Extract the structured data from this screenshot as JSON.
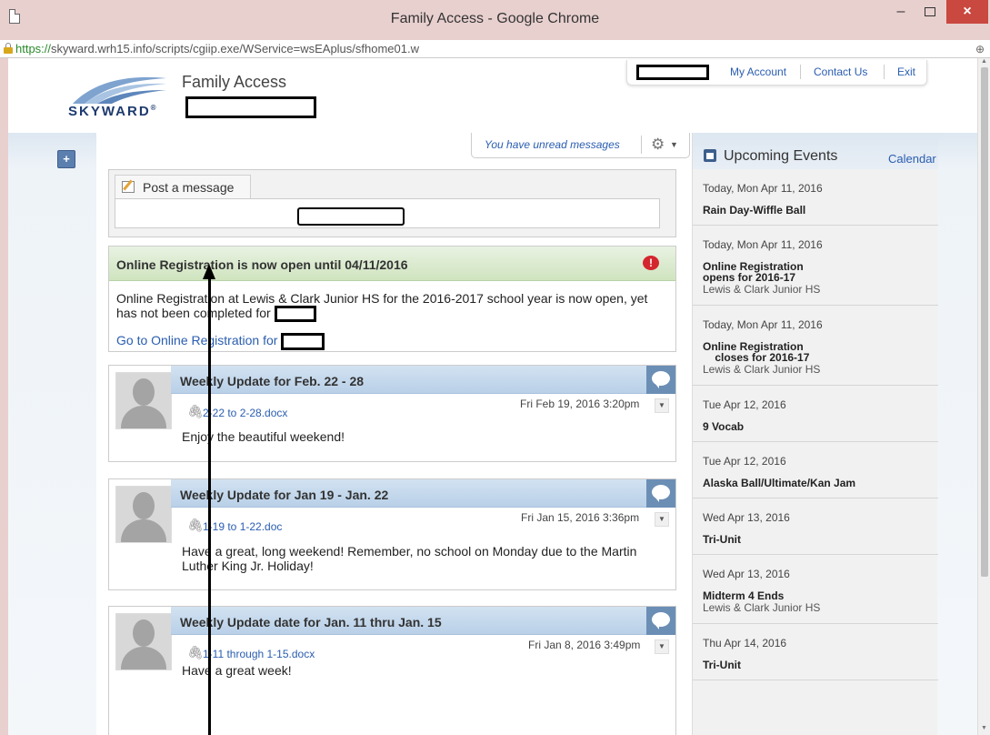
{
  "window": {
    "title": "Family Access - Google Chrome",
    "minimize": "–",
    "close": "×"
  },
  "url": {
    "scheme": "https://",
    "rest": "skyward.wrh15.info/scripts/cgiip.exe/WService=wsEAplus/sfhome01.w",
    "zoom": "⊕"
  },
  "header": {
    "logo_text": "SKYWARD",
    "logo_mark": "®",
    "app_title": "Family Access",
    "links": [
      "My Account",
      "Contact Us",
      "Exit"
    ]
  },
  "add_button": "+",
  "message_bar": {
    "text": "You have unread messages"
  },
  "post_box": {
    "tab_label": "Post a message"
  },
  "registration": {
    "title": "Online Registration is now open until 04/11/2016",
    "alert": "!",
    "body": "Online Registration at Lewis & Clark Junior HS for the 2016-2017 school year is now open, yet has not been completed for",
    "link": "Go to Online Registration for"
  },
  "posts": [
    {
      "title": "Weekly Update for Feb. 22 - 28",
      "attachment": "2-22 to 2-28.docx",
      "date": "Fri Feb 19, 2016 3:20pm",
      "body": "Enjoy the beautiful weekend!"
    },
    {
      "title": "Weekly Update for Jan 19 - Jan. 22",
      "attachment": "1-19 to 1-22.doc",
      "date": "Fri Jan 15, 2016 3:36pm",
      "body": "Have a great, long weekend! Remember, no school on Monday due to the Martin Luther King Jr. Holiday!"
    },
    {
      "title": "Weekly Update date for Jan. 11 thru Jan. 15",
      "attachment": "1-11 through 1-15.docx",
      "date": "Fri Jan 8, 2016 3:49pm",
      "body": "Have a great week!"
    }
  ],
  "events": {
    "title": "Upcoming Events",
    "calendar_link": "Calendar",
    "items": [
      {
        "date": "Today, Mon Apr 11, 2016",
        "title": "Rain Day-Wiffle Ball",
        "school": ""
      },
      {
        "date": "Today, Mon Apr 11, 2016",
        "title": "Online Registration\nopens for 2016-17",
        "school": "Lewis & Clark Junior HS"
      },
      {
        "date": "Today, Mon Apr 11, 2016",
        "title": "Online Registration\n    closes for 2016-17",
        "school": "Lewis & Clark Junior HS"
      },
      {
        "date": "Tue Apr 12, 2016",
        "title": "9 Vocab",
        "school": ""
      },
      {
        "date": "Tue Apr 12, 2016",
        "title": "Alaska Ball/Ultimate/Kan Jam",
        "school": ""
      },
      {
        "date": "Wed Apr 13, 2016",
        "title": "Tri-Unit",
        "school": ""
      },
      {
        "date": "Wed Apr 13, 2016",
        "title": "Midterm 4 Ends",
        "school": "Lewis & Clark Junior HS"
      },
      {
        "date": "Thu Apr 14, 2016",
        "title": "Tri-Unit",
        "school": ""
      }
    ]
  },
  "icons": {
    "gear": "gear-icon",
    "clip": "paperclip-icon",
    "bubble": "comment-bubble-icon",
    "calendar": "calendar-icon",
    "alert": "alert-icon",
    "lock": "lock-icon"
  },
  "colors": {
    "link": "#2a5db0",
    "title_bar": "#e8d0cf",
    "close_button": "#c9483f",
    "registration_header": "#cfe4bf",
    "post_header": "#b9d0e8",
    "alert": "#d4262e"
  }
}
